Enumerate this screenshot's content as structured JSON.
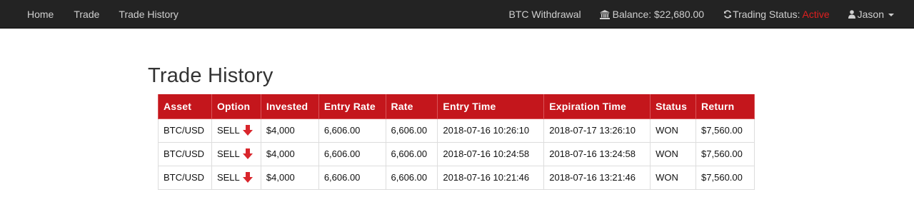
{
  "nav": {
    "home": "Home",
    "trade": "Trade",
    "trade_history": "Trade History",
    "btc_withdrawal": "BTC Withdrawal",
    "balance_label": "Balance: $22,680.00",
    "trading_status_label": "Trading Status:",
    "trading_status_value": "Active",
    "user_name": "Jason"
  },
  "page": {
    "title": "Trade History"
  },
  "table": {
    "headers": {
      "asset": "Asset",
      "option": "Option",
      "invested": "Invested",
      "entry_rate": "Entry Rate",
      "rate": "Rate",
      "entry_time": "Entry Time",
      "expiration_time": "Expiration Time",
      "status": "Status",
      "return": "Return"
    },
    "rows": [
      {
        "asset": "BTC/USD",
        "option": "SELL",
        "invested": "$4,000",
        "entry_rate": "6,606.00",
        "rate": "6,606.00",
        "entry_time": "2018-07-16 10:26:10",
        "expiration_time": "2018-07-17 13:26:10",
        "status": "WON",
        "return": "$7,560.00"
      },
      {
        "asset": "BTC/USD",
        "option": "SELL",
        "invested": "$4,000",
        "entry_rate": "6,606.00",
        "rate": "6,606.00",
        "entry_time": "2018-07-16 10:24:58",
        "expiration_time": "2018-07-16 13:24:58",
        "status": "WON",
        "return": "$7,560.00"
      },
      {
        "asset": "BTC/USD",
        "option": "SELL",
        "invested": "$4,000",
        "entry_rate": "6,606.00",
        "rate": "6,606.00",
        "entry_time": "2018-07-16 10:21:46",
        "expiration_time": "2018-07-16 13:21:46",
        "status": "WON",
        "return": "$7,560.00"
      }
    ]
  },
  "colors": {
    "navbar_bg": "#232323",
    "header_red": "#c4161c",
    "status_active": "#e01f1f",
    "sell_arrow": "#d9262c"
  },
  "icons": {
    "balance": "bank-icon",
    "status": "refresh-icon",
    "user": "user-icon",
    "sell": "arrow-down-icon"
  }
}
